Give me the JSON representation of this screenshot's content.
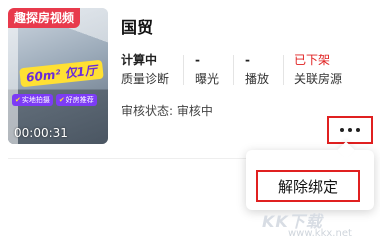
{
  "listing": {
    "thumbnail": {
      "tag": "趣探房视频",
      "promo": "60m² 仅1厅",
      "chips": [
        "实地拍摄",
        "好房推荐"
      ],
      "duration": "00:00:31"
    },
    "title": "国贸",
    "stats": [
      {
        "value": "计算中",
        "label": "质量诊断"
      },
      {
        "value": "-",
        "label": "曝光"
      },
      {
        "value": "-",
        "label": "播放"
      },
      {
        "value": "已下架",
        "label": "关联房源"
      }
    ],
    "review_label": "审核状态:",
    "review_status": "审核中"
  },
  "more_menu": {
    "items": [
      "解除绑定"
    ]
  },
  "watermark": {
    "text": "KK下载",
    "url": "www.kkx.net"
  },
  "colors": {
    "accent_red": "#e02020",
    "tag_red": "#e83a4c",
    "promo_yellow": "#ffe033",
    "chip_purple": "#7d3cf5"
  }
}
